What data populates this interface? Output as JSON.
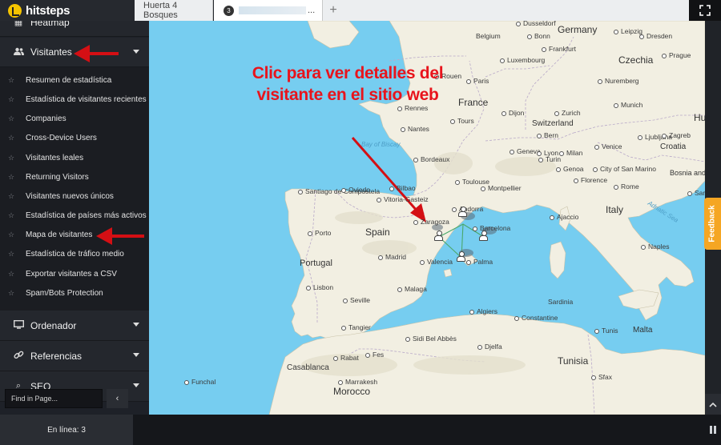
{
  "brand": {
    "name": "hitsteps"
  },
  "tabs": [
    {
      "label": "Huerta 4 Bosques"
    },
    {
      "badge": "3",
      "label": "..."
    }
  ],
  "tab_add": "+",
  "sidebar": {
    "heatmap": "Heatmap",
    "visitantes": "Visitantes",
    "submenu": [
      "Resumen de estadística",
      "Estadística de visitantes recientes",
      "Companies",
      "Cross-Device Users",
      "Visitantes leales",
      "Returning Visitors",
      "Visitantes nuevos únicos",
      "Estadística de países más activos",
      "Mapa de visitantes",
      "Estadística de tráfico medio",
      "Exportar visitantes a CSV",
      "Spam/Bots Protection"
    ],
    "ordenador": "Ordenador",
    "referencias": "Referencias",
    "seo": "SEO"
  },
  "find": {
    "placeholder": "Find in Page...",
    "button": "‹"
  },
  "footer": {
    "online": "En línea: 3"
  },
  "annotation": "Clic para ver detalles del visitante en el sitio web",
  "feedback": "Feedback",
  "map": {
    "countries": [
      "Germany",
      "Czechia",
      "France",
      "Switzerland",
      "Hunga",
      "Croatia",
      "Italy",
      "Bosnia and Herzegovina",
      "Spain",
      "Portugal",
      "Morocco",
      "Tunisia",
      "Malta"
    ],
    "cities": [
      "Dusseldorf",
      "Bonn",
      "Leipzig",
      "Dresden",
      "Belgium",
      "Luxembourg",
      "Frankfurt",
      "Prague",
      "Nuremberg",
      "Munich",
      "Paris",
      "Rouen",
      "Rennes",
      "Nantes",
      "Tours",
      "Dijon",
      "Zurich",
      "Bern",
      "Geneva",
      "Lyon",
      "Bordeaux",
      "Toulouse",
      "Montpellier",
      "Genoa",
      "Milan",
      "Turin",
      "Venice",
      "Ljubljana",
      "Zagreb",
      "Sarajevo",
      "City of San Marino",
      "Florence",
      "Rome",
      "Ajaccio",
      "Naples",
      "Santiago de Compostela",
      "Oviedo",
      "Bilbao",
      "Vitoria-Gasteiz",
      "Zaragoza",
      "Barcelona",
      "Andorra",
      "Porto",
      "Madrid",
      "Valencia",
      "Palma",
      "Lisbon",
      "Seville",
      "Malaga",
      "Tangier",
      "Algiers",
      "Constantine",
      "Sidi Bel Abbès",
      "Djelfa",
      "Rabat",
      "Fes",
      "Casablanca",
      "Marrakesh",
      "Funchal",
      "Tunis",
      "Sfax",
      "Sardinia",
      "Bay of Biscay",
      "Adriatic Sea"
    ]
  }
}
